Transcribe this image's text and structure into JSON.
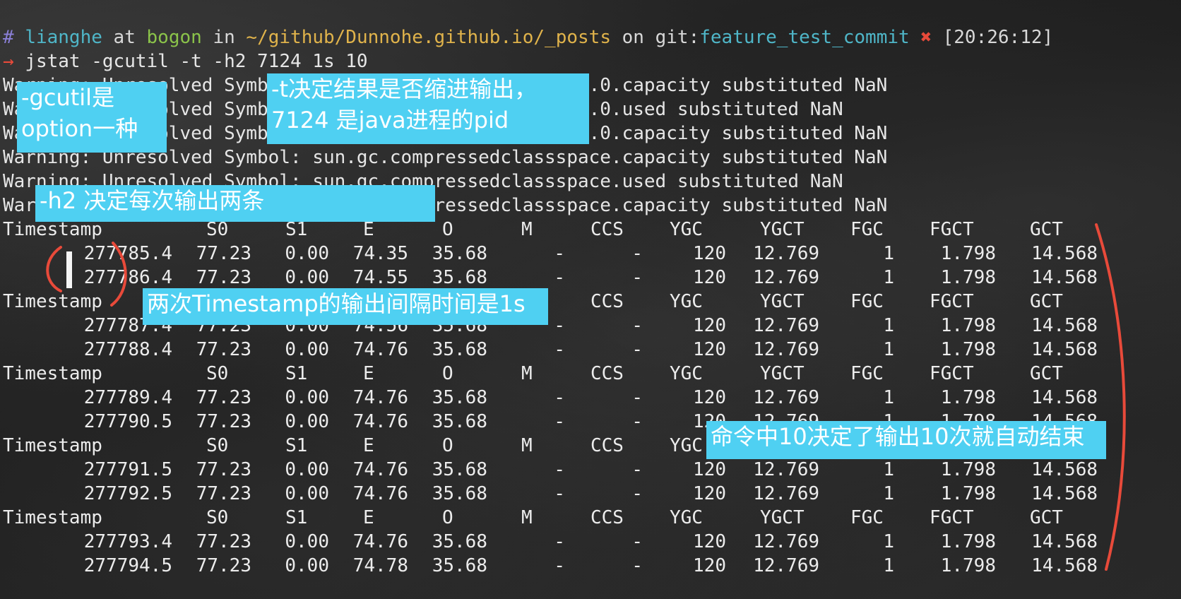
{
  "prompt": {
    "hash": "#",
    "user": "lianghe",
    "at": " at ",
    "host": "bogon",
    "in": " in ",
    "path": "~/github/Dunnohe.github.io/_posts",
    "on": " on ",
    "git_prefix": "git:",
    "branch": "feature_test_commit",
    "dirty_mark": "✖",
    "time": "[20:26:12]"
  },
  "command": {
    "arrow": "→",
    "text": "jstat -gcutil -t -h2 7124 1s 10"
  },
  "warnings": [
    "Warning: Unresolved Symbol: sun.gc.generation.2.space.0.capacity substituted NaN",
    "Warning: Unresolved Symbol: sun.gc.generation.2.space.0.used substituted NaN",
    "Warning: Unresolved Symbol: sun.gc.generation.2.space.0.capacity substituted NaN",
    "Warning: Unresolved Symbol: sun.gc.compressedclassspace.capacity substituted NaN",
    "Warning: Unresolved Symbol: sun.gc.compressedclassspace.used substituted NaN",
    "Warning: Unresolved Symbol: sun.gc.compressedclassspace.capacity substituted NaN"
  ],
  "headers": [
    "Timestamp",
    "S0",
    "S1",
    "E",
    "O",
    "M",
    "CCS",
    "YGC",
    "YGCT",
    "FGC",
    "FGCT",
    "GCT"
  ],
  "rows": [
    [
      "277785.4",
      "77.23",
      "0.00",
      "74.35",
      "35.68",
      "-",
      "-",
      "120",
      "12.769",
      "1",
      "1.798",
      "14.568"
    ],
    [
      "277786.4",
      "77.23",
      "0.00",
      "74.55",
      "35.68",
      "-",
      "-",
      "120",
      "12.769",
      "1",
      "1.798",
      "14.568"
    ],
    [
      "277787.4",
      "77.23",
      "0.00",
      "74.56",
      "35.68",
      "-",
      "-",
      "120",
      "12.769",
      "1",
      "1.798",
      "14.568"
    ],
    [
      "277788.4",
      "77.23",
      "0.00",
      "74.76",
      "35.68",
      "-",
      "-",
      "120",
      "12.769",
      "1",
      "1.798",
      "14.568"
    ],
    [
      "277789.4",
      "77.23",
      "0.00",
      "74.76",
      "35.68",
      "-",
      "-",
      "120",
      "12.769",
      "1",
      "1.798",
      "14.568"
    ],
    [
      "277790.5",
      "77.23",
      "0.00",
      "74.76",
      "35.68",
      "-",
      "-",
      "120",
      "12.769",
      "1",
      "1.798",
      "14.568"
    ],
    [
      "277791.5",
      "77.23",
      "0.00",
      "74.76",
      "35.68",
      "-",
      "-",
      "120",
      "12.769",
      "1",
      "1.798",
      "14.568"
    ],
    [
      "277792.5",
      "77.23",
      "0.00",
      "74.76",
      "35.68",
      "-",
      "-",
      "120",
      "12.769",
      "1",
      "1.798",
      "14.568"
    ],
    [
      "277793.4",
      "77.23",
      "0.00",
      "74.76",
      "35.68",
      "-",
      "-",
      "120",
      "12.769",
      "1",
      "1.798",
      "14.568"
    ],
    [
      "277794.5",
      "77.23",
      "0.00",
      "74.78",
      "35.68",
      "-",
      "-",
      "120",
      "12.769",
      "1",
      "1.798",
      "14.568"
    ]
  ],
  "callouts": {
    "gcutil": "-gcutil是\noption一种",
    "t_option": "-t决定结果是否缩进输出，\n7124 是java进程的pid",
    "h2": "-h2 决定每次输出两条",
    "interval": "两次Timestamp的输出间隔时间是1s",
    "count": "命令中10决定了输出10次就自动结束"
  },
  "colors": {
    "callout_bg": "#4fd0f2",
    "annotation_red": "#e84a3a",
    "prompt_user": "#4fb6c8",
    "prompt_host": "#8bc34a",
    "prompt_path": "#e0b34b"
  }
}
